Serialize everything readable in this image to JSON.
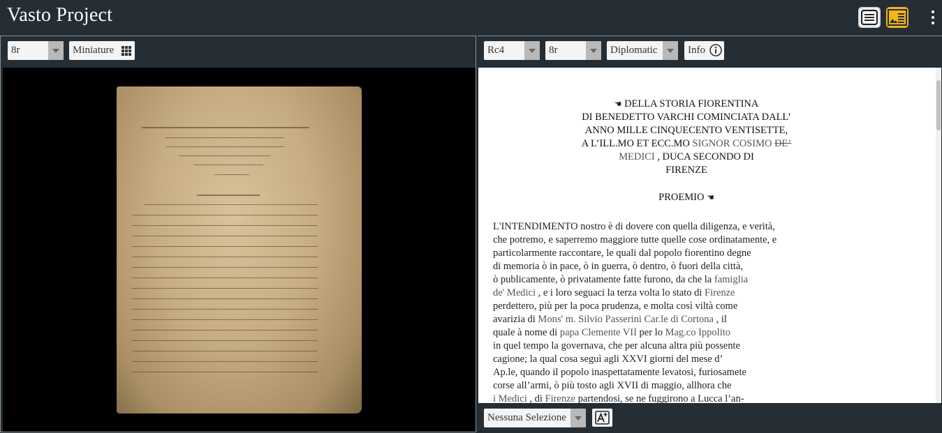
{
  "app": {
    "title": "Vasto Project"
  },
  "left_panel": {
    "page_select": "8r",
    "miniature_label": "Miniature"
  },
  "right_panel": {
    "witness_select": "Rc4",
    "page_select": "8r",
    "edition_select": "Diplomatic",
    "info_label": "Info",
    "selection_select": "Nessuna Selezione",
    "heading_lines": [
      [
        "DELLA STORIA FIORENTINA"
      ],
      [
        "DI BENEDETTO VARCHI COMINCIATA DALL’"
      ],
      [
        "ANNO MILLE CINQUECENTO VENTISETTE,"
      ],
      [
        "A L’ILL.MO ET ECC.MO ",
        "SIGNOR COSIMO",
        " ",
        "DE’"
      ],
      [
        "MEDICI",
        " , DUCA SECONDO DI"
      ],
      [
        "FIRENZE"
      ]
    ],
    "proemio": "PROEMIO",
    "body_lines": [
      [
        "L'INTENDIMENTO nostro è di dovere con quella diligenza, e verità,"
      ],
      [
        "che potremo, e saperremo maggiore tutte quelle cose ordinatamente, e"
      ],
      [
        "particolarmente raccontare, le quali dal popolo fiorentino degne"
      ],
      [
        "di memoria ò in pace, ò in guerra, ò dentro, ò fuori della città,"
      ],
      [
        "ò publicamente, ò privatamente fatte furono, da che la ",
        "famiglia"
      ],
      [
        "de' Medici",
        " , e i loro seguaci la terza volta lo stato di ",
        "Firenze"
      ],
      [
        "perdettero, più per la poca prudenza, e molta così viltà come"
      ],
      [
        "avarizia di ",
        "Mons' m. Silvio Passerini Car.le di Cortona",
        " , il"
      ],
      [
        "quale à nome di ",
        "papa Clemente VII",
        " per lo ",
        "Mag.co Ippolito"
      ],
      [
        "in quel tempo la governava, che per alcuna altra più possente"
      ],
      [
        "cagione; la qual cosa seguì agli XXVI giorni del mese d’"
      ],
      [
        "Ap.le, quando il popolo inaspettatamente levatosi, furiosamete"
      ],
      [
        "corse all’armi, ò più tosto agli XVII di maggio, allhora che"
      ],
      [
        "i Medici",
        " , di ",
        "Firenze",
        " partendosi, se ne fuggirono a Lucca l’an-"
      ]
    ]
  },
  "icons": {
    "text_view": "text-view-icon",
    "image_text_view": "image-text-view-icon",
    "menu": "kebab-menu-icon",
    "miniature": "grid-icon",
    "info": "info-icon",
    "font_size": "font-size-icon",
    "manicule": "manicule-icon"
  },
  "colors": {
    "accent": "#f2b518",
    "toolbar": "#252e35",
    "entity_text": "#555555"
  }
}
